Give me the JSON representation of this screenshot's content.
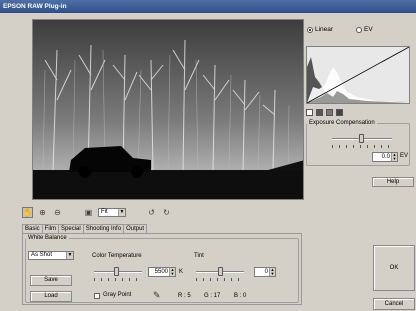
{
  "window": {
    "title": "EPSON RAW Plug-in"
  },
  "curve_mode": {
    "linear_label": "Linear",
    "ev_label": "EV",
    "selected": "Linear"
  },
  "exposure": {
    "legend": "Exposure Compensation",
    "value": "0.0",
    "unit": "EV"
  },
  "buttons": {
    "help": "Help",
    "ok": "OK",
    "cancel": "Cancel"
  },
  "toolbar": {
    "zoom_value": "Fit"
  },
  "tabs": [
    "Basic",
    "Film",
    "Special",
    "Shooting Info",
    "Output"
  ],
  "white_balance": {
    "legend": "White Balance",
    "mode": "As Shot",
    "save_label": "Save",
    "load_label": "Load",
    "color_temp_label": "Color Temperature",
    "color_temp_value": "5500",
    "color_temp_unit": "K",
    "tint_label": "Tint",
    "tint_value": "0",
    "gray_point_label": "Gray Point",
    "rgb_readout": {
      "r": "R : 5",
      "g": "G : 17",
      "b": "B : 0"
    }
  },
  "colors": {
    "titlebar": "#2f4f88",
    "dialog": "#d4d0c8",
    "histogram_bg": "#e8e8e8"
  },
  "icons": [
    "hand-icon",
    "zoom-in-icon",
    "zoom-out-icon",
    "fit-screen-icon",
    "rotate-left-icon",
    "rotate-right-icon",
    "eyedropper-icon"
  ]
}
